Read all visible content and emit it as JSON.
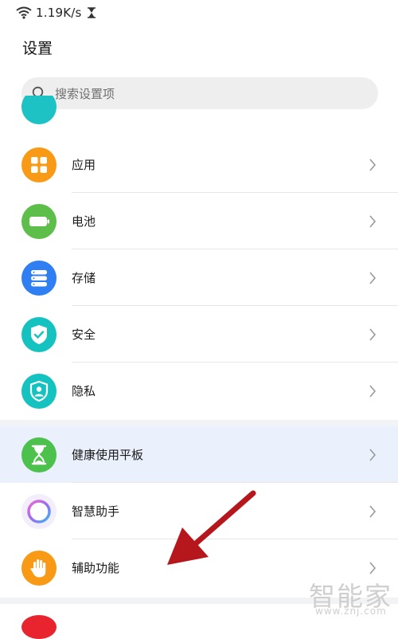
{
  "status_bar": {
    "net_speed": "1.19K/s",
    "icons": [
      "wifi-icon",
      "hourglass-icon"
    ]
  },
  "page": {
    "title": "设置"
  },
  "search": {
    "placeholder": "搜索设置项",
    "value": ""
  },
  "settings_items": [
    {
      "label": "应用",
      "icon": "apps-icon",
      "color": "#f99a16"
    },
    {
      "label": "电池",
      "icon": "battery-icon",
      "color": "#5dbe49"
    },
    {
      "label": "存储",
      "icon": "storage-icon",
      "color": "#2f7ff2"
    },
    {
      "label": "安全",
      "icon": "shield-check-icon",
      "color": "#14c2c0"
    },
    {
      "label": "隐私",
      "icon": "privacy-shield-icon",
      "color": "#14c2c0"
    },
    {
      "label": "健康使用平板",
      "icon": "hourglass-icon",
      "color": "#4cc24c",
      "highlighted": true
    },
    {
      "label": "智慧助手",
      "icon": "assistant-ring-icon",
      "color": "#a86fe8"
    },
    {
      "label": "辅助功能",
      "icon": "hand-icon",
      "color": "#f99a16"
    }
  ],
  "watermark": {
    "name": "智能家",
    "url": "www.znj.com"
  },
  "colors": {
    "highlight": "#eaf0fc",
    "annotation_arrow": "#b5171d"
  }
}
